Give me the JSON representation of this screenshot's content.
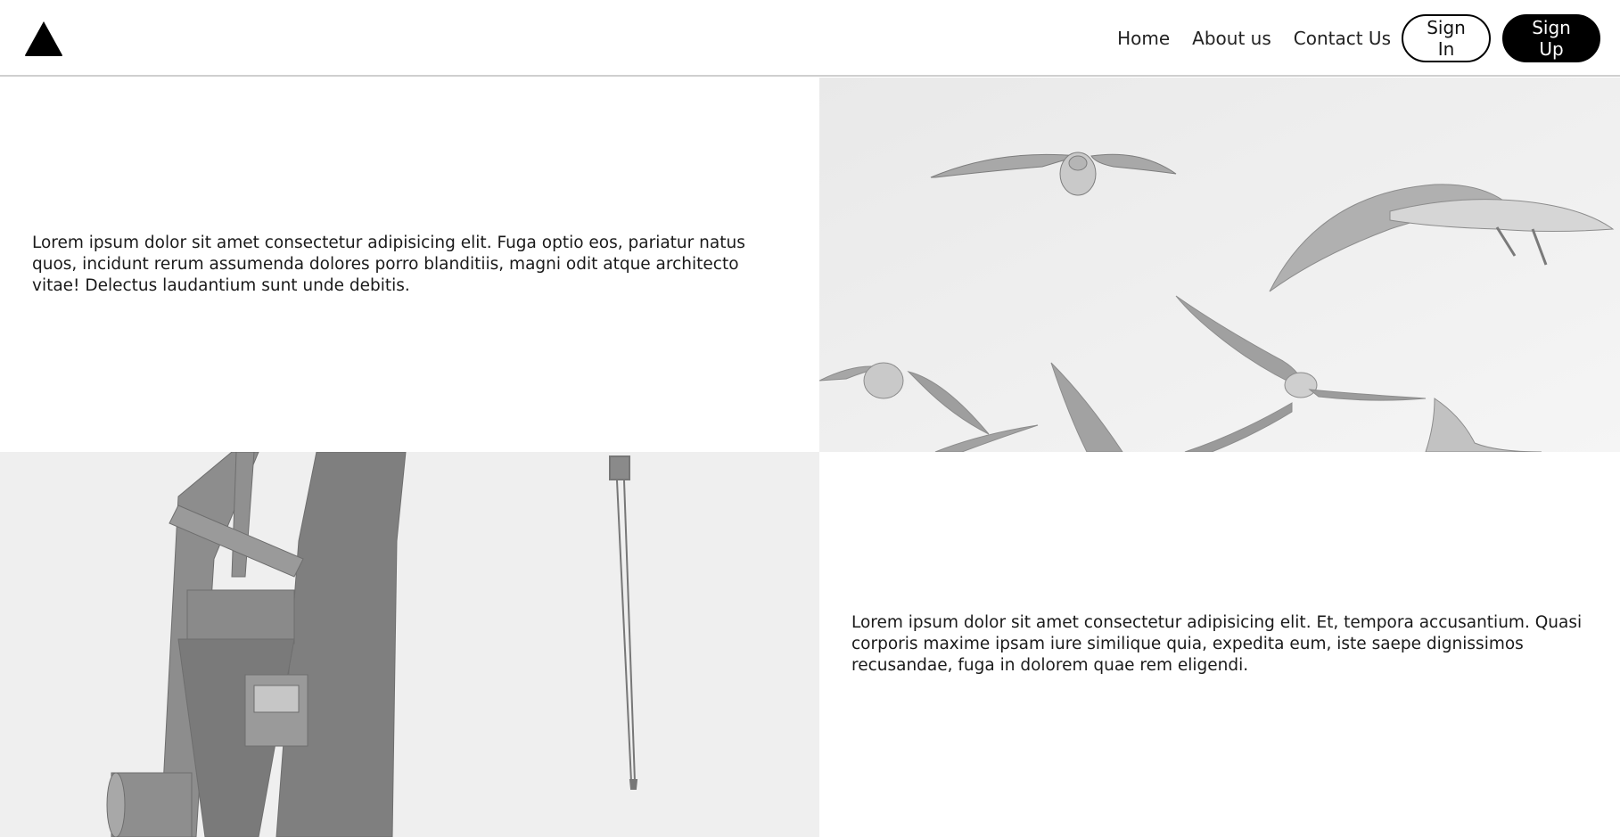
{
  "nav": {
    "logo_icon": "triangle-logo-icon",
    "links": {
      "home": "Home",
      "about": "About us",
      "contact": "Contact Us"
    },
    "sign_in": "Sign In",
    "sign_up": "Sign Up"
  },
  "sections": {
    "first": {
      "text": "Lorem ipsum dolor sit amet consectetur adipisicing elit. Fuga optio eos, pariatur natus quos, incidunt rerum assumenda dolores porro blanditiis, magni odit atque architecto vitae! Delectus laudantium sunt unde debitis.",
      "image": "seagulls-photo"
    },
    "second": {
      "text": "Lorem ipsum dolor sit amet consectetur adipisicing elit. Et, tempora accusantium. Quasi corporis maxime ipsam iure similique quia, expedita eum, iste saepe dignissimos recusandae, fuga in dolorem quae rem eligendi.",
      "image": "crane-photo"
    }
  },
  "colors": {
    "primary": "#000000",
    "background": "#ffffff",
    "photo_tint": "#e8e8e8"
  }
}
